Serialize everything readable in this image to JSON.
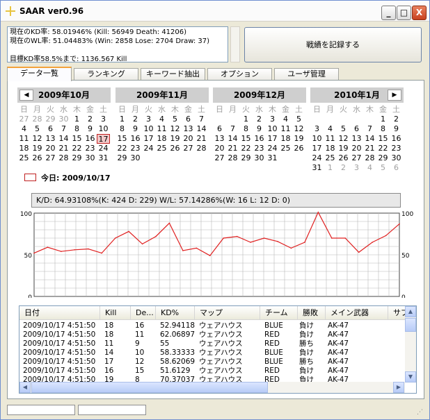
{
  "window": {
    "title": "SAAR ver0.96",
    "minimize": "_",
    "maximize": "□",
    "close": "X"
  },
  "status": {
    "lines": "現在のKD率: 58.01946% (Kill: 56949 Death: 41206)\n現在のWL率: 51.04483% (Win: 2858 Lose: 2704 Draw: 37)\n\n目標KD率58.5%まで: 1136.567 Kill"
  },
  "record_button": "戦績を記録する",
  "tabs": [
    "データ一覧",
    "ランキング",
    "キーワード抽出",
    "オプション",
    "ユーザ管理"
  ],
  "weekdays": [
    "日",
    "月",
    "火",
    "水",
    "木",
    "金",
    "土"
  ],
  "calendar": [
    {
      "title": "2009年10月",
      "days": [
        [
          "27",
          "28",
          "29",
          "30",
          "1",
          "2",
          "3"
        ],
        [
          "4",
          "5",
          "6",
          "7",
          "8",
          "9",
          "10"
        ],
        [
          "11",
          "12",
          "13",
          "14",
          "15",
          "16",
          "17"
        ],
        [
          "18",
          "19",
          "20",
          "21",
          "22",
          "23",
          "24"
        ],
        [
          "25",
          "26",
          "27",
          "28",
          "29",
          "30",
          "31"
        ]
      ],
      "other_month_rows": [
        0
      ],
      "other_month_cols": [
        [
          0,
          1,
          2,
          3
        ]
      ]
    },
    {
      "title": "2009年11月",
      "days": [
        [
          "1",
          "2",
          "3",
          "4",
          "5",
          "6",
          "7"
        ],
        [
          "8",
          "9",
          "10",
          "11",
          "12",
          "13",
          "14"
        ],
        [
          "15",
          "16",
          "17",
          "18",
          "19",
          "20",
          "21"
        ],
        [
          "22",
          "23",
          "24",
          "25",
          "26",
          "27",
          "28"
        ],
        [
          "29",
          "30",
          "",
          "",
          "",
          "",
          ""
        ]
      ]
    },
    {
      "title": "2009年12月",
      "days": [
        [
          "",
          "",
          "1",
          "2",
          "3",
          "4",
          "5"
        ],
        [
          "6",
          "7",
          "8",
          "9",
          "10",
          "11",
          "12"
        ],
        [
          "13",
          "14",
          "15",
          "16",
          "17",
          "18",
          "19"
        ],
        [
          "20",
          "21",
          "22",
          "23",
          "24",
          "25",
          "26"
        ],
        [
          "27",
          "28",
          "29",
          "30",
          "31",
          "",
          ""
        ]
      ]
    },
    {
      "title": "2010年1月",
      "days": [
        [
          "",
          "",
          "",
          "",
          "",
          "1",
          "2"
        ],
        [
          "3",
          "4",
          "5",
          "6",
          "7",
          "8",
          "9"
        ],
        [
          "10",
          "11",
          "12",
          "13",
          "14",
          "15",
          "16"
        ],
        [
          "17",
          "18",
          "19",
          "20",
          "21",
          "22",
          "23"
        ],
        [
          "24",
          "25",
          "26",
          "27",
          "28",
          "29",
          "30"
        ],
        [
          "31",
          "1",
          "2",
          "3",
          "4",
          "5",
          "6"
        ]
      ]
    }
  ],
  "nav": {
    "prev": "◀",
    "next": "▶"
  },
  "today_label": "今日: 2009/10/17",
  "stats_text": "K/D: 64.93108%(K: 424  D: 229)  W/L: 57.14286%(W: 16  L: 12  D: 0)",
  "chart_data": {
    "type": "line",
    "ylim": [
      0,
      100
    ],
    "yticks": [
      "100",
      "50",
      "0"
    ],
    "grid": true,
    "color": "#e02020",
    "values": [
      52,
      59,
      54,
      56,
      57,
      52,
      70,
      78,
      63,
      72,
      88,
      55,
      58,
      49,
      70,
      72,
      65,
      70,
      66,
      58,
      65,
      101,
      70,
      70,
      53,
      65,
      73,
      87
    ]
  },
  "list": {
    "headers": [
      "日付",
      "Kill",
      "De...",
      "KD%",
      "マップ",
      "チーム",
      "勝敗",
      "メイン武器",
      "サブ"
    ],
    "rows": [
      [
        "2009/10/17 4:51:50",
        "18",
        "16",
        "52.94118",
        "ウェアハウス",
        "BLUE",
        "負け",
        "AK-47"
      ],
      [
        "2009/10/17 4:51:50",
        "18",
        "11",
        "62.06897",
        "ウェアハウス",
        "RED",
        "負け",
        "AK-47"
      ],
      [
        "2009/10/17 4:51:50",
        "11",
        "9",
        "55",
        "ウェアハウス",
        "RED",
        "勝ち",
        "AK-47"
      ],
      [
        "2009/10/17 4:51:50",
        "14",
        "10",
        "58.33333",
        "ウェアハウス",
        "BLUE",
        "負け",
        "AK-47"
      ],
      [
        "2009/10/17 4:51:50",
        "17",
        "12",
        "58.62069",
        "ウェアハウス",
        "BLUE",
        "勝ち",
        "AK-47"
      ],
      [
        "2009/10/17 4:51:50",
        "16",
        "15",
        "51.6129",
        "ウェアハウス",
        "RED",
        "負け",
        "AK-47"
      ],
      [
        "2009/10/17 4:51:50",
        "19",
        "8",
        "70.37037",
        "ウェアハウス",
        "RED",
        "負け",
        "AK-47"
      ]
    ]
  }
}
